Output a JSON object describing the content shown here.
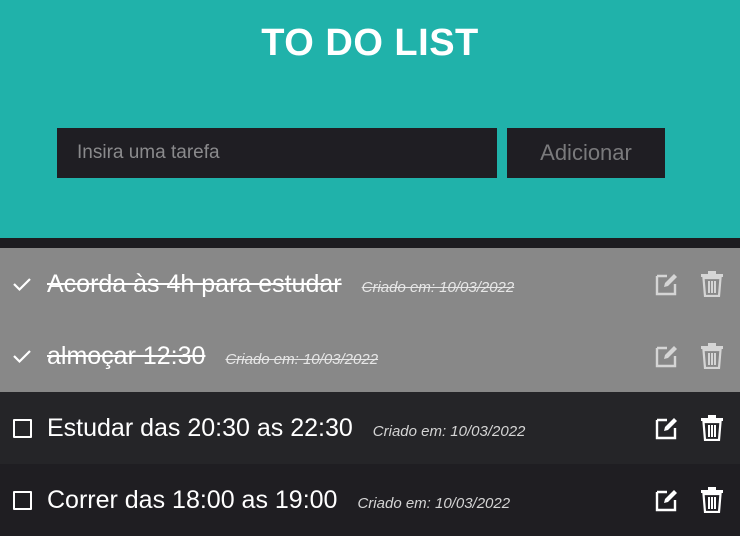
{
  "header": {
    "title": "TO DO LIST",
    "input_placeholder": "Insira uma tarefa",
    "add_button_label": "Adicionar"
  },
  "tasks": [
    {
      "name": "Acorda às 4h para estudar",
      "created": "Criado em: 10/03/2022",
      "completed": true
    },
    {
      "name": "almoçar 12:30",
      "created": "Criado em: 10/03/2022",
      "completed": true
    },
    {
      "name": "Estudar das 20:30 as 22:30",
      "created": "Criado em: 10/03/2022",
      "completed": false
    },
    {
      "name": "Correr das 18:00 as 19:00",
      "created": "Criado em: 10/03/2022",
      "completed": false
    }
  ],
  "icons": {
    "complete": "check-icon",
    "incomplete": "checkbox-icon",
    "edit": "edit-icon",
    "delete": "trash-icon"
  },
  "colors": {
    "header_bg": "#20b2aa",
    "completed_row_bg": "#888888",
    "pending_row_bg": "#252528",
    "input_bg": "#1f1e23"
  }
}
